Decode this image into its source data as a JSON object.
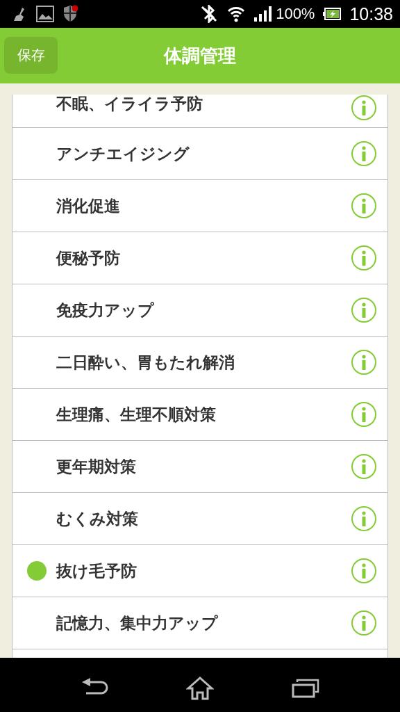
{
  "status_bar": {
    "battery": "100%",
    "time": "10:38"
  },
  "header": {
    "save_button": "保存",
    "title": "体調管理"
  },
  "items": [
    {
      "label": "不眠、イライラ予防",
      "selected": false
    },
    {
      "label": "アンチエイジング",
      "selected": false
    },
    {
      "label": "消化促進",
      "selected": false
    },
    {
      "label": "便秘予防",
      "selected": false
    },
    {
      "label": "免疫力アップ",
      "selected": false
    },
    {
      "label": "二日酔い、胃もたれ解消",
      "selected": false
    },
    {
      "label": "生理痛、生理不順対策",
      "selected": false
    },
    {
      "label": "更年期対策",
      "selected": false
    },
    {
      "label": "むくみ対策",
      "selected": false
    },
    {
      "label": "抜け毛予防",
      "selected": true
    },
    {
      "label": "記憶力、集中力アップ",
      "selected": false
    }
  ]
}
